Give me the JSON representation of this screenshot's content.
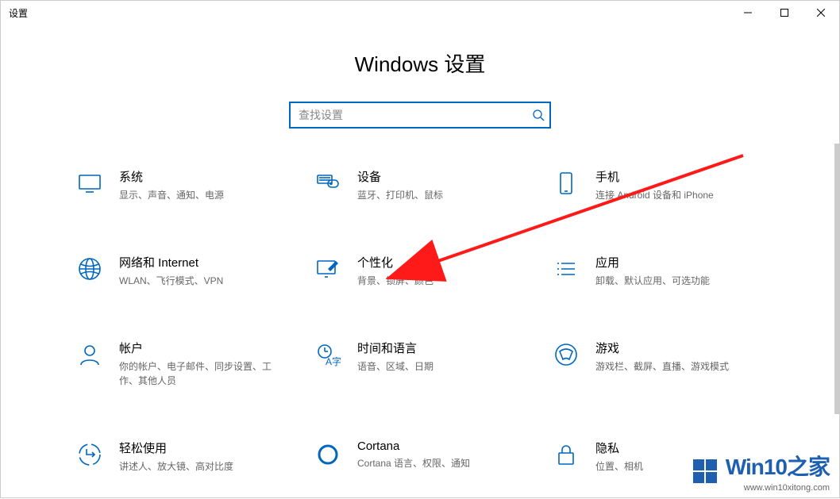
{
  "window": {
    "title": "设置"
  },
  "page": {
    "heading": "Windows 设置"
  },
  "search": {
    "placeholder": "查找设置"
  },
  "cards": {
    "system": {
      "label": "系统",
      "desc": "显示、声音、通知、电源"
    },
    "devices": {
      "label": "设备",
      "desc": "蓝牙、打印机、鼠标"
    },
    "phone": {
      "label": "手机",
      "desc": "连接 Android 设备和 iPhone"
    },
    "network": {
      "label": "网络和 Internet",
      "desc": "WLAN、飞行模式、VPN"
    },
    "personalize": {
      "label": "个性化",
      "desc": "背景、锁屏、颜色"
    },
    "apps": {
      "label": "应用",
      "desc": "卸载、默认应用、可选功能"
    },
    "accounts": {
      "label": "帐户",
      "desc": "你的帐户、电子邮件、同步设置、工作、其他人员"
    },
    "time": {
      "label": "时间和语言",
      "desc": "语音、区域、日期"
    },
    "gaming": {
      "label": "游戏",
      "desc": "游戏栏、截屏、直播、游戏模式"
    },
    "ease": {
      "label": "轻松使用",
      "desc": "讲述人、放大镜、高对比度"
    },
    "cortana": {
      "label": "Cortana",
      "desc": "Cortana 语言、权限、通知"
    },
    "privacy": {
      "label": "隐私",
      "desc": "位置、相机"
    }
  },
  "watermark": {
    "title": "Win10之家",
    "url": "www.win10xitong.com"
  }
}
